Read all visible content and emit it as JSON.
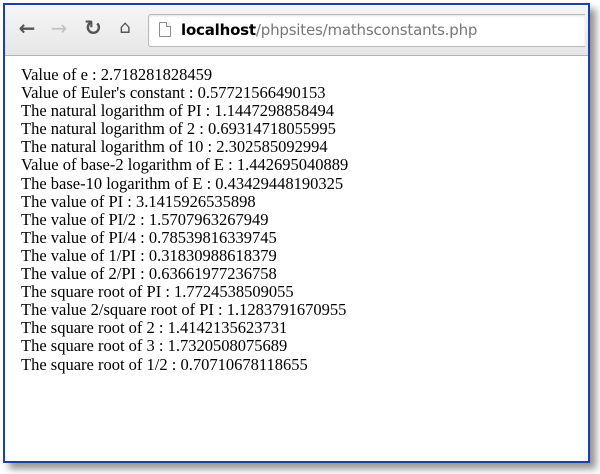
{
  "browser": {
    "back_icon": "arrow-left-icon",
    "forward_icon": "arrow-right-icon",
    "reload_icon": "reload-icon",
    "home_icon": "home-icon",
    "page_icon": "page-icon",
    "url_host": "localhost",
    "url_path": "/phpsites/mathsconstants.php"
  },
  "lines": [
    "Value of e : 2.718281828459",
    "Value of Euler's constant : 0.57721566490153",
    "The natural logarithm of PI : 1.1447298858494",
    "The natural logarithm of 2 : 0.69314718055995",
    "The natural logarithm of 10 : 2.302585092994",
    "Value of base-2 logarithm of E : 1.442695040889",
    "The base-10 logarithm of E : 0.43429448190325",
    "The value of PI : 3.1415926535898",
    "The value of PI/2 : 1.5707963267949",
    "The value of PI/4 : 0.78539816339745",
    "The value of 1/PI : 0.31830988618379",
    "The value of 2/PI : 0.63661977236758",
    "The square root of PI : 1.7724538509055",
    "The value 2/square root of PI : 1.1283791670955",
    "The square root of 2 : 1.4142135623731",
    "The square root of 3 : 1.7320508075689",
    "The square root of 1/2 : 0.70710678118655"
  ]
}
